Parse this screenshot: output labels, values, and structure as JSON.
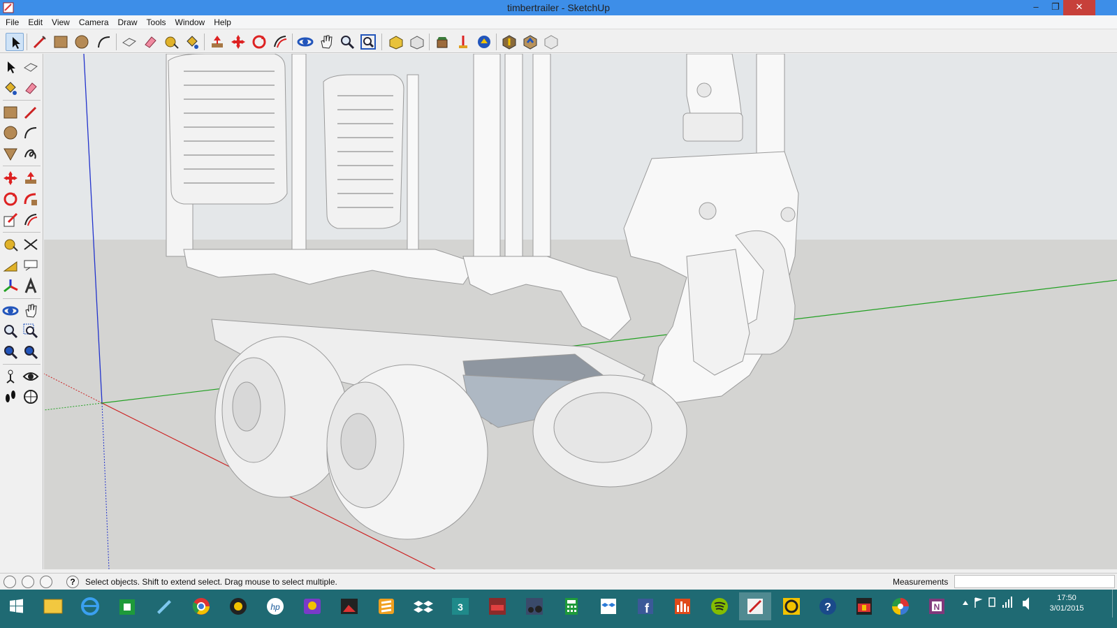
{
  "window": {
    "title": "timbertrailer - SketchUp",
    "minimize": "–",
    "restore": "❐",
    "close": "✕"
  },
  "menu": [
    "File",
    "Edit",
    "View",
    "Camera",
    "Draw",
    "Tools",
    "Window",
    "Help"
  ],
  "status": {
    "hint": "Select objects. Shift to extend select. Drag mouse to select multiple.",
    "measurements_label": "Measurements",
    "measurements_value": ""
  },
  "clock": {
    "time": "17:50",
    "date": "3/01/2015"
  },
  "colors": {
    "titlebar": "#3d8ee8",
    "taskbar": "#1f6a73",
    "sky": "#e4e7e9",
    "ground": "#d4d4d2",
    "axis_red": "#cc2222",
    "axis_green": "#22a022",
    "axis_blue": "#2233cc"
  },
  "toolbar_icons": [
    "select-icon",
    "line-icon",
    "rectangle-icon",
    "circle-icon",
    "arc-icon",
    "make-component-icon",
    "eraser-icon",
    "tape-measure-icon",
    "paint-bucket-icon",
    "push-pull-icon",
    "move-icon",
    "rotate-icon",
    "offset-icon",
    "orbit-icon",
    "pan-icon",
    "zoom-icon",
    "zoom-extents-icon",
    "3d-warehouse-icon",
    "share-model-icon",
    "extension-warehouse-icon",
    "layout-icon",
    "style-builder-icon",
    "get-models-icon",
    "share-component-icon",
    "extension-icon"
  ],
  "taskbar_apps": [
    "windows-start-icon",
    "file-explorer-icon",
    "internet-explorer-icon",
    "store-icon",
    "rocket-app-icon",
    "chrome-icon",
    "media-player-icon",
    "hp-icon",
    "game-app-icon",
    "photo-app-icon",
    "sublime-icon",
    "dropbox-icon",
    "3ds-max-icon",
    "racing-game-icon",
    "tractor-game-icon",
    "calculator-icon",
    "dropbox-alt-icon",
    "facebook-icon",
    "equalizer-icon",
    "spotify-icon",
    "sketchup-icon",
    "circle-app-icon",
    "help-icon",
    "studio-icon",
    "picasa-icon",
    "onenote-icon"
  ]
}
